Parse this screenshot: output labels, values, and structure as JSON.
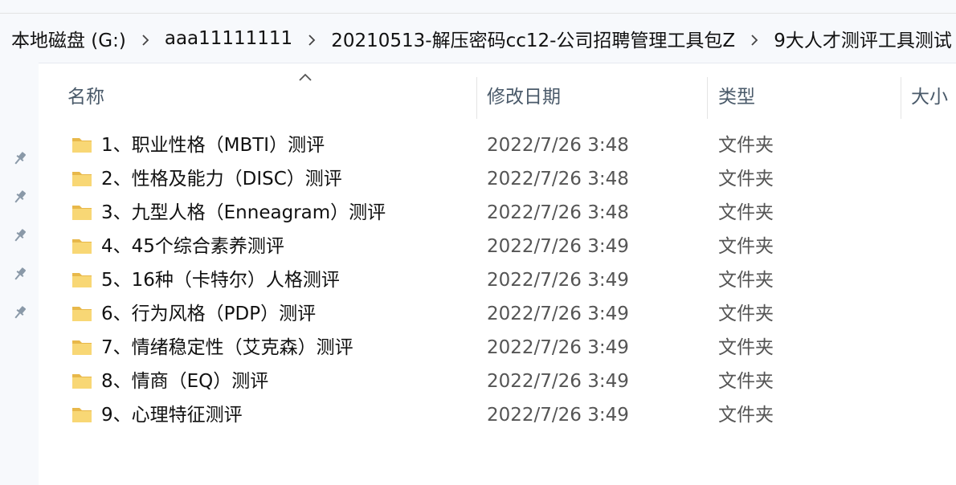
{
  "breadcrumb": [
    "本地磁盘 (G:)",
    "aaa11111111",
    "20210513-解压密码cc12-公司招聘管理工具包Z",
    "9大人才测评工具测试"
  ],
  "columns": {
    "name": "名称",
    "date": "修改日期",
    "type": "类型",
    "size": "大小"
  },
  "files": [
    {
      "name": "1、职业性格（MBTI）测评",
      "date": "2022/7/26 3:48",
      "type": "文件夹"
    },
    {
      "name": "2、性格及能力（DISC）测评",
      "date": "2022/7/26 3:48",
      "type": "文件夹"
    },
    {
      "name": "3、九型人格（Enneagram）测评",
      "date": "2022/7/26 3:48",
      "type": "文件夹"
    },
    {
      "name": "4、45个综合素养测评",
      "date": "2022/7/26 3:49",
      "type": "文件夹"
    },
    {
      "name": "5、16种（卡特尔）人格测评",
      "date": "2022/7/26 3:49",
      "type": "文件夹"
    },
    {
      "name": "6、行为风格（PDP）测评",
      "date": "2022/7/26 3:49",
      "type": "文件夹"
    },
    {
      "name": "7、情绪稳定性（艾克森）测评",
      "date": "2022/7/26 3:49",
      "type": "文件夹"
    },
    {
      "name": "8、情商（EQ）测评",
      "date": "2022/7/26 3:49",
      "type": "文件夹"
    },
    {
      "name": "9、心理特征测评",
      "date": "2022/7/26 3:49",
      "type": "文件夹"
    }
  ],
  "icons": {
    "breadcrumb_separator": "chevron-right-icon",
    "sort": "chevron-up-icon",
    "pin": "pin-icon",
    "folder": "folder-icon"
  },
  "colors": {
    "folder": "#f8d775",
    "folder_dark": "#e8b84a",
    "address_bg": "#f7f9fc",
    "pin": "#8a99a8",
    "header_text": "#4a5a6a"
  }
}
